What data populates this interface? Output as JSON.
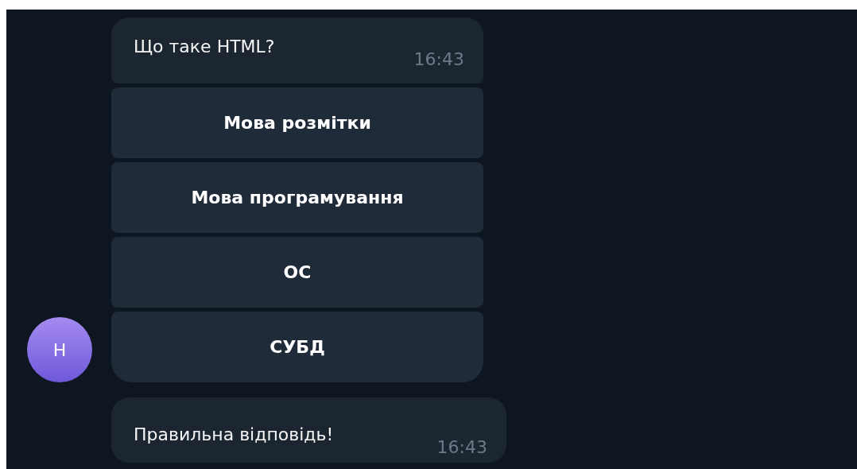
{
  "messages": [
    {
      "kind": "question",
      "text": "Що таке HTML?",
      "time": "16:43",
      "avatar": "Н",
      "buttons": [
        "Мова розмітки",
        "Мова програмування",
        "ОС",
        "СУБД"
      ]
    },
    {
      "kind": "reply",
      "text": "Правильна відповідь!",
      "time": "16:43"
    }
  ]
}
